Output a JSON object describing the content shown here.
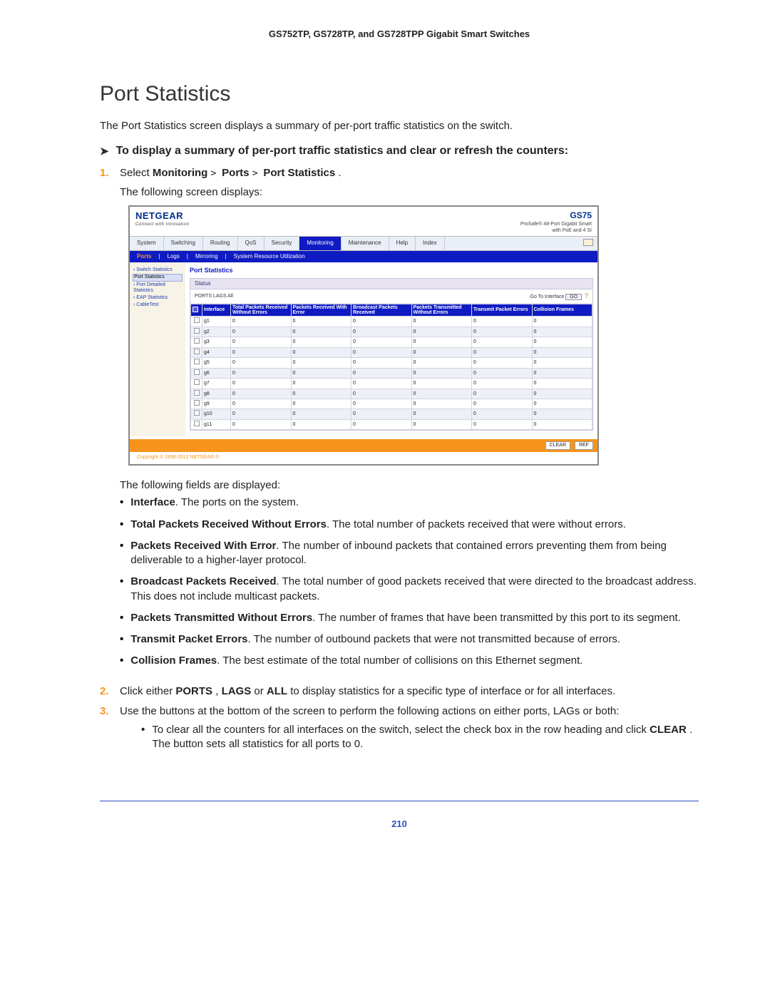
{
  "header": {
    "running": "GS752TP, GS728TP, and GS728TPP Gigabit Smart Switches"
  },
  "title": "Port Statistics",
  "intro_text": "The Port Statistics screen displays a summary of per-port traffic statistics on the switch.",
  "howto_arrow": "➤",
  "howto_text": "To display a summary of per-port traffic statistics and clear or refresh the counters:",
  "step1": {
    "num": "1.",
    "prefix": "Select ",
    "path_a": "Monitoring",
    "sep": " > ",
    "path_b": "Ports",
    "path_c": "Port Statistics",
    "period": ".",
    "followup": "The following screen displays:"
  },
  "fields_intro": "The following fields are displayed:",
  "fields": [
    {
      "term": "Interface",
      "desc": ". The ports on the system."
    },
    {
      "term": "Total Packets Received Without Errors",
      "desc": ". The total number of packets received that were without errors."
    },
    {
      "term": "Packets Received With Error",
      "desc": ". The number of inbound packets that contained errors preventing them from being deliverable to a higher-layer protocol."
    },
    {
      "term": "Broadcast Packets Received",
      "desc": ". The total number of good packets received that were directed to the broadcast address. This does not include multicast packets."
    },
    {
      "term": "Packets Transmitted Without Errors",
      "desc": ". The number of frames that have been transmitted by this port to its segment."
    },
    {
      "term": "Transmit Packet Errors",
      "desc": ". The number of outbound packets that were not transmitted because of errors."
    },
    {
      "term": "Collision Frames",
      "desc": ". The best estimate of the total number of collisions on this Ethernet segment."
    }
  ],
  "step2": {
    "num": "2.",
    "pre": "Click either ",
    "a": "PORTS",
    "comma": ", ",
    "b": "LAGS",
    "or": " or ",
    "c": "ALL",
    "post": " to display statistics for a specific type of interface or for all interfaces."
  },
  "step3": {
    "num": "3.",
    "text": "Use the buttons at the bottom of the screen to perform the following actions on either ports, LAGs or both:",
    "sub_pre": "To clear all the counters for all interfaces on the switch, select the check box in the row heading and click ",
    "sub_bold": "CLEAR",
    "sub_post": ". The button sets all statistics for all ports to 0."
  },
  "page_number": "210",
  "ui": {
    "logo": "NETGEAR",
    "logo_tag": "Connect with Innovation",
    "model": "GS75",
    "model_sub1": "ProSafe® 48-Port Gigabit Smart",
    "model_sub2": "with PoE and 4 SI",
    "tabs": [
      "System",
      "Switching",
      "Routing",
      "QoS",
      "Security",
      "Monitoring",
      "Maintenance",
      "Help",
      "Index"
    ],
    "active_tab_index": 5,
    "subtabs": {
      "items": [
        "Ports",
        "Logs",
        "Mirroring",
        "System Resource Utilization"
      ],
      "active_index": 0
    },
    "sidebar": [
      "Switch Statistics",
      "Port Statistics",
      "Port Detailed Statistics",
      "EAP Statistics",
      "CableTest"
    ],
    "sidebar_selected_index": 1,
    "main_title": "Port Statistics",
    "panel_head": "Status",
    "filter_left": "PORTS LAGS All",
    "filter_right_label": "Go To Interface",
    "go_btn": "GO",
    "help_icon": "?",
    "columns": [
      "",
      "Interface",
      "Total Packets Received Without Errors",
      "Packets Received With Error",
      "Broadcast Packets Received",
      "Packets Transmitted Without Errors",
      "Transmit Packet Errors",
      "Collision Frames"
    ],
    "rows": [
      {
        "if": "g1",
        "a": "0",
        "b": "0",
        "c": "0",
        "d": "0",
        "e": "0",
        "f": "0"
      },
      {
        "if": "g2",
        "a": "0",
        "b": "0",
        "c": "0",
        "d": "0",
        "e": "0",
        "f": "0"
      },
      {
        "if": "g3",
        "a": "0",
        "b": "0",
        "c": "0",
        "d": "0",
        "e": "0",
        "f": "0"
      },
      {
        "if": "g4",
        "a": "0",
        "b": "0",
        "c": "0",
        "d": "0",
        "e": "0",
        "f": "0"
      },
      {
        "if": "g5",
        "a": "0",
        "b": "0",
        "c": "0",
        "d": "0",
        "e": "0",
        "f": "0"
      },
      {
        "if": "g6",
        "a": "0",
        "b": "0",
        "c": "0",
        "d": "0",
        "e": "0",
        "f": "0"
      },
      {
        "if": "g7",
        "a": "0",
        "b": "0",
        "c": "0",
        "d": "0",
        "e": "0",
        "f": "0"
      },
      {
        "if": "g8",
        "a": "0",
        "b": "0",
        "c": "0",
        "d": "0",
        "e": "0",
        "f": "0"
      },
      {
        "if": "g9",
        "a": "0",
        "b": "0",
        "c": "0",
        "d": "0",
        "e": "0",
        "f": "0"
      },
      {
        "if": "g10",
        "a": "0",
        "b": "0",
        "c": "0",
        "d": "0",
        "e": "0",
        "f": "0"
      },
      {
        "if": "g11",
        "a": "0",
        "b": "0",
        "c": "0",
        "d": "0",
        "e": "0",
        "f": "0"
      }
    ],
    "footer_buttons": [
      "CLEAR",
      "REF"
    ],
    "copyright": "Copyright © 1996-2012 NETGEAR ®"
  }
}
